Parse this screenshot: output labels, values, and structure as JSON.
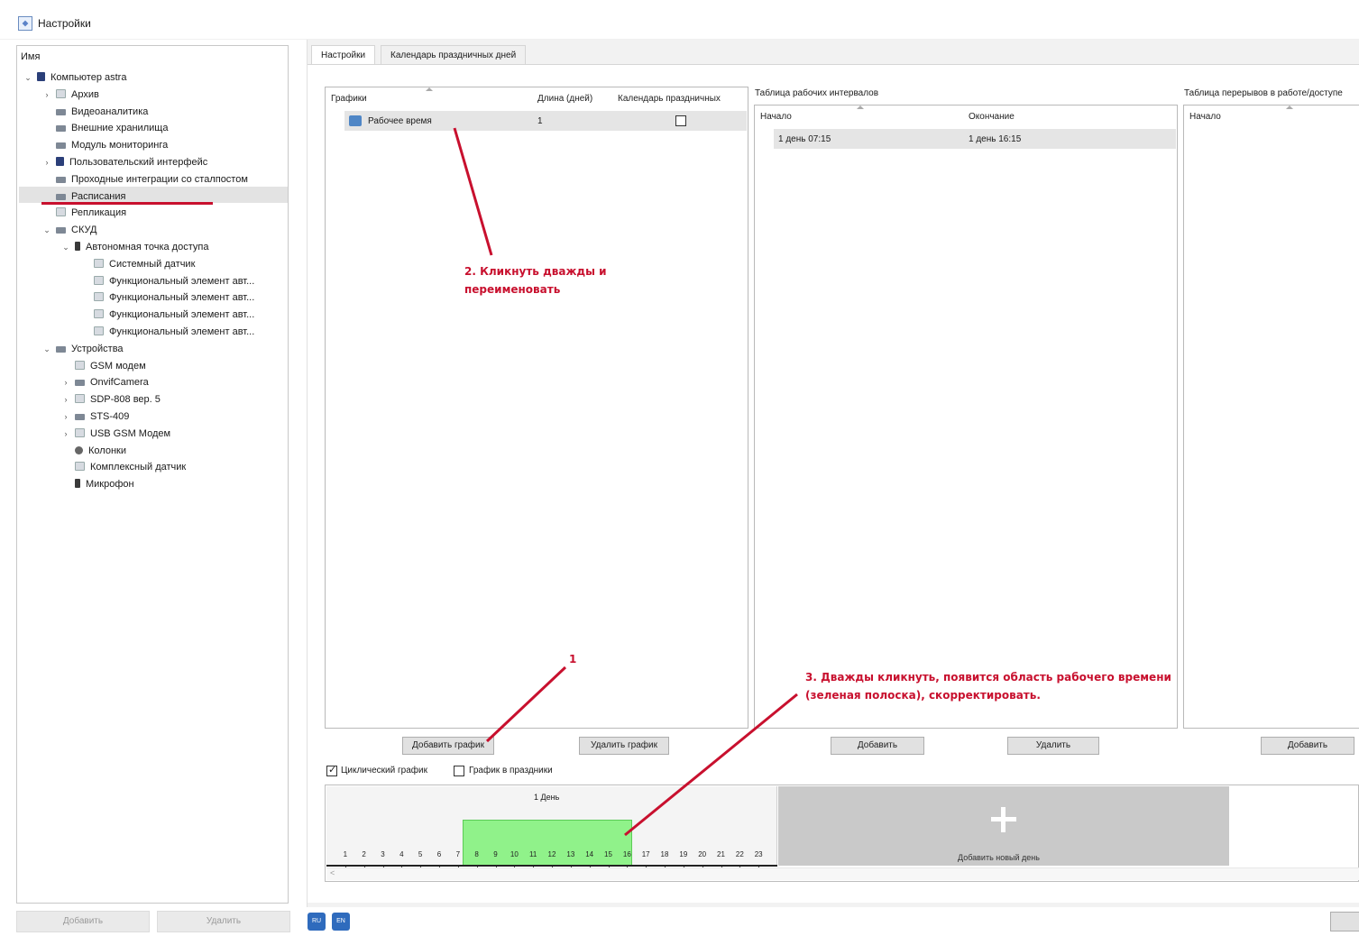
{
  "window": {
    "title": "Настройки"
  },
  "tree": {
    "header": "Имя",
    "items": [
      {
        "label": "Компьютер astra",
        "toggle": "⌄",
        "icon": "computer-icon",
        "level": 0
      },
      {
        "label": "Архив",
        "toggle": "›",
        "icon": "archive-icon",
        "level": 1
      },
      {
        "label": "Видеоаналитика",
        "toggle": "",
        "icon": "folder-icon",
        "level": 1
      },
      {
        "label": "Внешние хранилища",
        "toggle": "",
        "icon": "folder-icon",
        "level": 1
      },
      {
        "label": "Модуль мониторинга",
        "toggle": "",
        "icon": "folder-icon",
        "level": 1
      },
      {
        "label": "Пользовательский интерфейс",
        "toggle": "›",
        "icon": "monitor-icon",
        "level": 1
      },
      {
        "label": "Проходные интеграции со сталпостом",
        "toggle": "",
        "icon": "folder-icon",
        "level": 1
      },
      {
        "label": "Расписания",
        "toggle": "",
        "icon": "folder-icon",
        "level": 1
      },
      {
        "label": "Репликация",
        "toggle": "",
        "icon": "device-icon",
        "level": 1
      },
      {
        "label": "СКУД",
        "toggle": "⌄",
        "icon": "folder-icon",
        "level": 1
      },
      {
        "label": "Автономная точка доступа",
        "toggle": "⌄",
        "icon": "access-point-icon",
        "level": 2
      },
      {
        "label": "Системный датчик",
        "toggle": "",
        "icon": "sensor-icon",
        "level": 3
      },
      {
        "label": "Функциональный элемент авт...",
        "toggle": "",
        "icon": "element-icon",
        "level": 3
      },
      {
        "label": "Функциональный элемент авт...",
        "toggle": "",
        "icon": "element-icon",
        "level": 3
      },
      {
        "label": "Функциональный элемент авт...",
        "toggle": "",
        "icon": "element-icon",
        "level": 3
      },
      {
        "label": "Функциональный элемент авт...",
        "toggle": "",
        "icon": "element-icon",
        "level": 3
      },
      {
        "label": "Устройства",
        "toggle": "⌄",
        "icon": "folder-icon",
        "level": 1
      },
      {
        "label": "GSM модем",
        "toggle": "",
        "icon": "device-icon",
        "level": 2
      },
      {
        "label": "OnvifCamera",
        "toggle": "›",
        "icon": "folder-icon",
        "level": 2
      },
      {
        "label": "SDP-808 вер. 5",
        "toggle": "›",
        "icon": "device-icon",
        "level": 2
      },
      {
        "label": "STS-409",
        "toggle": "›",
        "icon": "folder-icon",
        "level": 2
      },
      {
        "label": "USB GSM Модем",
        "toggle": "›",
        "icon": "device-icon",
        "level": 2
      },
      {
        "label": "Колонки",
        "toggle": "",
        "icon": "speaker-icon",
        "level": 2
      },
      {
        "label": "Комплексный датчик",
        "toggle": "",
        "icon": "sensor-icon",
        "level": 2
      },
      {
        "label": "Микрофон",
        "toggle": "",
        "icon": "microphone-icon",
        "level": 2
      }
    ],
    "add_button": "Добавить",
    "delete_button": "Удалить"
  },
  "tabs": [
    "Настройки",
    "Календарь праздничных дней"
  ],
  "schedules": {
    "columns": [
      "Графики",
      "Длина (дней)",
      "Календарь праздничных"
    ],
    "rows": [
      {
        "name": "Рабочее время",
        "length": "1"
      }
    ],
    "add_button": "Добавить график",
    "delete_button": "Удалить график"
  },
  "intervals": {
    "title": "Таблица рабочих интервалов",
    "columns": [
      "Начало",
      "Окончание"
    ],
    "rows": [
      {
        "start": "1 день 07:15",
        "end": "1 день 16:15"
      }
    ],
    "add_button": "Добавить",
    "delete_button": "Удалить"
  },
  "breaks": {
    "title": "Таблица перерывов в работе/доступе",
    "columns": [
      "Начало"
    ],
    "add_button": "Добавить"
  },
  "options": {
    "cyclic_label": "Циклический график",
    "holidays_label": "График в праздники"
  },
  "timeline": {
    "day_label": "1 День",
    "hours": [
      "1",
      "2",
      "3",
      "4",
      "5",
      "6",
      "7",
      "8",
      "9",
      "10",
      "11",
      "12",
      "13",
      "14",
      "15",
      "16",
      "17",
      "18",
      "19",
      "20",
      "21",
      "22",
      "23"
    ],
    "work_start_hour": 7.25,
    "work_end_hour": 16.25,
    "add_day_label": "Добавить новый день"
  },
  "annotations": {
    "step1": "1",
    "step2_line1": "2. Кликнуть дважды и",
    "step2_line2": "переименовать",
    "step3_line1": "3. Дважды кликнуть, появится область рабочего времени",
    "step3_line2": "(зеленая полоска), скорректировать."
  },
  "footer": {
    "lang_ru": "RU",
    "lang_alt": "EN"
  },
  "colors": {
    "annotation": "#c8102e",
    "work_area": "#90f28a",
    "selection": "#e3e3e3"
  }
}
